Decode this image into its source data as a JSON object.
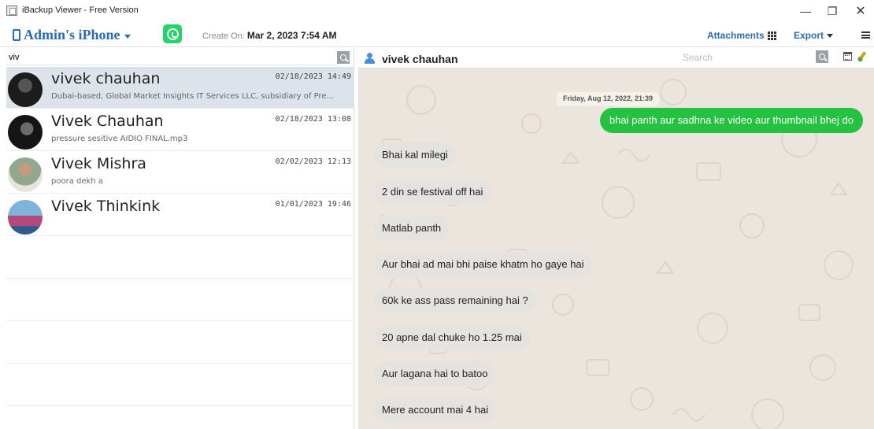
{
  "window": {
    "title": "iBackup Viewer - Free Version",
    "controls": {
      "minimize": "—",
      "maximize": "❐",
      "close": "✕"
    }
  },
  "toolbar": {
    "device_name": "Admin's iPhone",
    "create_on_label": "Create On:",
    "create_on_value": "Mar 2, 2023 7:54 AM",
    "attachments_label": "Attachments",
    "export_label": "Export",
    "accent_color": "#2b6cb0",
    "whatsapp_color": "#25d366"
  },
  "contacts": {
    "search_value": "viv",
    "items": [
      {
        "name": "vivek chauhan",
        "date": "02/18/2023 14:49",
        "preview": "Dubai-based, Global Market Insights IT Services LLC, subsidiary of Pre...",
        "selected": true,
        "avatar": "avatar-dark-person"
      },
      {
        "name": "Vivek Chauhan",
        "date": "02/18/2023 13:08",
        "preview": "pressure sesitive AIDIO FINAL.mp3",
        "selected": false,
        "avatar": "avatar-dark-person"
      },
      {
        "name": "Vivek Mishra",
        "date": "02/02/2023 12:13",
        "preview": "poora dekh a",
        "selected": false,
        "avatar": "avatar-person-outdoor"
      },
      {
        "name": "Vivek Thinkink",
        "date": "01/01/2023 19:46",
        "preview": "",
        "selected": false,
        "avatar": "avatar-person-sky"
      }
    ]
  },
  "chat": {
    "contact_name": "vivek chauhan",
    "search_placeholder": "Search",
    "date_separator": "Friday, Aug 12, 2022, 21:39",
    "outgoing_color": "#25c241",
    "messages": [
      {
        "direction": "out",
        "text": "bhai panth aur sadhna ke video aur thumbnail bhej do"
      },
      {
        "direction": "in",
        "text": "Bhai kal milegi"
      },
      {
        "direction": "in",
        "text": "2 din se festival off hai"
      },
      {
        "direction": "in",
        "text": "Matlab panth"
      },
      {
        "direction": "in",
        "text": "Aur bhai ad mai bhi paise khatm ho gaye hai"
      },
      {
        "direction": "in",
        "text": "60k ke ass pass remaining hai ?"
      },
      {
        "direction": "in",
        "text": "20 apne dal chuke ho 1.25 mai"
      },
      {
        "direction": "in",
        "text": "Aur lagana hai to batoo"
      },
      {
        "direction": "in",
        "text": "Mere account mai 4 hai"
      }
    ]
  }
}
